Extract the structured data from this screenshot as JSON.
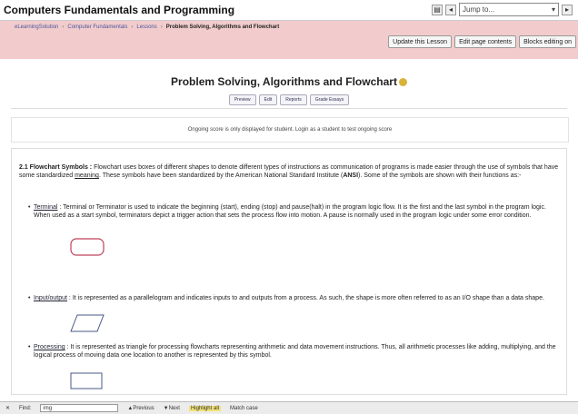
{
  "header": {
    "course_title": "Computers Fundamentals and Programming",
    "jump_to": "Jump to..."
  },
  "breadcrumb": {
    "items": [
      "eLearningSolution",
      "Computer Fundamentals",
      "Lessons",
      "Problem Solving, Algorithms and Flowchart"
    ]
  },
  "nav_buttons": {
    "update": "Update this Lesson",
    "edit_page": "Edit page contents",
    "blocks": "Blocks editing on"
  },
  "lesson": {
    "title": "Problem Solving, Algorithms and Flowchart",
    "tabs": [
      "Preview",
      "Edit",
      "Reports",
      "Grade Essays"
    ]
  },
  "notice": "Ongoing score is only displayed for student. Login as a student to test ongoing score",
  "content": {
    "intro_head": "2.1 Flowchart Symbols :",
    "intro_a": " Flowchart uses boxes of different shapes to denote different types of instructions as communication of programs is made easier through the use of symbols that have some standardized ",
    "intro_meaning": "meaning",
    "intro_b": ". These symbols have been standardized by the American National Standard Institute (",
    "intro_ansi": "ANSI",
    "intro_c": "). Some of the symbols are shown with their functions as:-",
    "bullets": [
      {
        "term": "Terminal",
        "text": " : Terminal or Terminator is used to indicate the beginning (start), ending (stop) and pause(halt) in the program logic flow. It is the first and the last symbol in the program logic. When used as a start symbol, terminators depict a trigger action that sets the process flow into motion. A pause is normally used in the program logic under some error condition."
      },
      {
        "term": "Input/output",
        "text": " : It is represented as a parallelogram and indicates inputs to and outputs from a process. As such, the shape is more often referred to as an I/O shape than a data shape."
      },
      {
        "term": "Processing",
        "text": " : It is represented as triangle for processing flowcharts representing arithmetic and data movement instructions. Thus, all arithmetic processes like adding, multiplying, and the logical process of moving data one location to another is represented by this symbol."
      }
    ]
  },
  "statusbar": {
    "find_label": "Find:",
    "find_value": "img",
    "previous": "Previous",
    "next": "Next",
    "highlight": "Highlight all",
    "match_case": "Match case"
  },
  "colors": {
    "navbar_bg": "#f2cccc",
    "terminal_shape": "#c0405a",
    "shape_stroke": "#4a5a8a"
  }
}
